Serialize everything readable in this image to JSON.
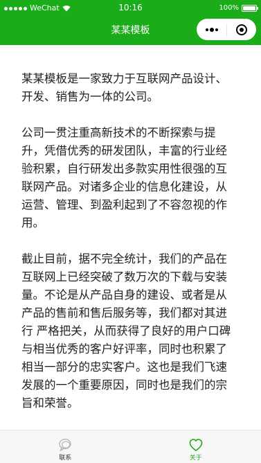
{
  "status_bar": {
    "carrier": "WeChat",
    "time": "10:16",
    "battery": "100%"
  },
  "nav_bar": {
    "title": "某某模板"
  },
  "content": {
    "paragraphs": [
      "某某模板是一家致力于互联网产品设计、开发、销售为一体的公司。",
      "公司一贯注重高新技术的不断探索与提升，凭借优秀的研发团队，丰富的行业经验积累，自行研发出多款实用性很强的互联网产品。对诸多企业的信息化建设，从运营、管理、到盈利起到了不容忽视的作用。",
      "截止目前，据不完全统计，我们的产品在互联网上已经突破了数万次的下载与安装量。不论是从产品自身的建设、或者是从产品的售前和售后服务等，我们都对其进行 严格把关，从而获得了良好的用户口碑与相当优秀的客户好评率，同时也积累了相当一部分的忠实客户。这也是我们飞速发展的一个重要原因，同时也是我们的宗旨和荣誉。"
    ]
  },
  "tab_bar": {
    "tabs": [
      {
        "label": "联系",
        "icon": "chat-bubble-icon",
        "active": false
      },
      {
        "label": "关于",
        "icon": "heart-icon",
        "active": true
      }
    ]
  },
  "colors": {
    "brand": "#1aad19",
    "text": "#222222",
    "tab_bg": "#f7f7f7"
  }
}
